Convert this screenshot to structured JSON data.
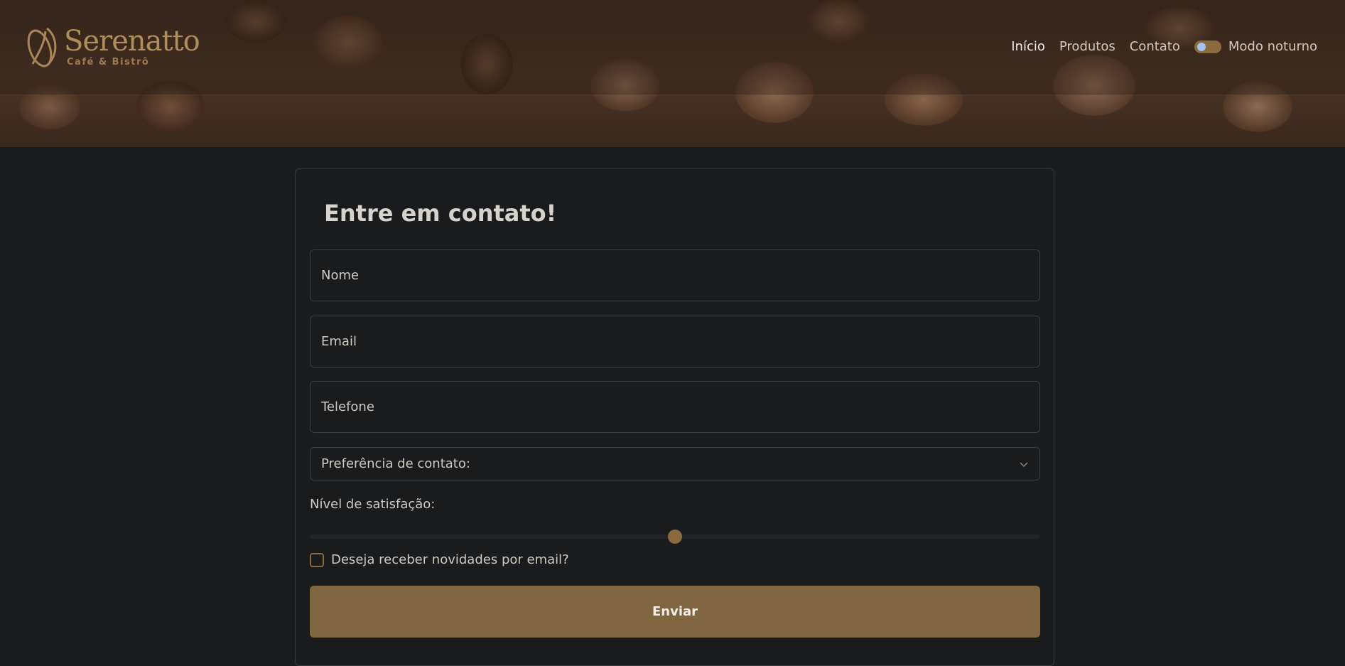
{
  "brand": {
    "name": "Serenatto",
    "tagline": "Café & Bistrô"
  },
  "nav": {
    "items": [
      {
        "label": "Início",
        "active": true
      },
      {
        "label": "Produtos",
        "active": false
      },
      {
        "label": "Contato",
        "active": false
      }
    ],
    "night_mode_label": "Modo noturno"
  },
  "form": {
    "title": "Entre em contato!",
    "name_placeholder": "Nome",
    "email_placeholder": "Email",
    "phone_placeholder": "Telefone",
    "contact_preference": "Preferência de contato:",
    "satisfaction_label": "Nível de satisfação:",
    "satisfaction_fraction": 0.5,
    "newsletter_label": "Deseja receber novidades por email?",
    "newsletter_checked": false,
    "submit_label": "Enviar"
  },
  "colors": {
    "accent": "#7f6540",
    "background": "#1a1b1d",
    "brand": "#b08d5c"
  }
}
